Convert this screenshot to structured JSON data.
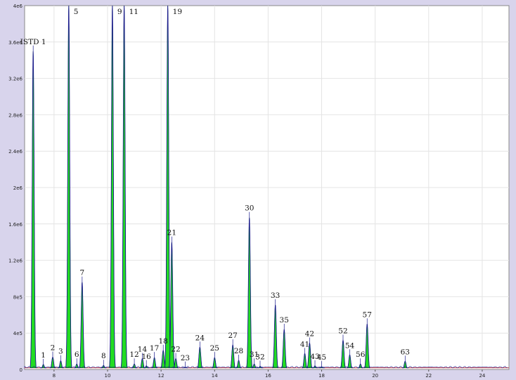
{
  "chart_data": {
    "type": "line",
    "title": "",
    "xlabel": "",
    "ylabel": "",
    "xlim": [
      6.9,
      25.0
    ],
    "ylim": [
      0,
      4000000
    ],
    "grid": true,
    "legend": "none",
    "x_ticks": [
      8,
      10,
      12,
      14,
      16,
      18,
      20,
      22,
      24
    ],
    "x_tick_labels": [
      "8",
      "10",
      "12",
      "14",
      "16",
      "18",
      "20",
      "22",
      "24"
    ],
    "y_ticks": [
      0,
      400000,
      800000,
      1200000,
      1600000,
      2000000,
      2400000,
      2800000,
      3200000,
      3600000,
      4000000
    ],
    "y_tick_labels": [
      "0",
      "4e5",
      "8e5",
      "1.2e6",
      "1.6e6",
      "2e6",
      "2.4e6",
      "2.8e6",
      "3.2e6",
      "3.6e6",
      "4e6"
    ],
    "colors": {
      "trace": "#1a1a8c",
      "fill": "#22dd22",
      "fill_stroke": "#0a7a0a",
      "baseline": "#cc3333",
      "plot_bg": "#ffffff",
      "grid": "#e4e4e4"
    },
    "peaks": [
      {
        "label": "ISTD 1",
        "x": 7.22,
        "y": 3500000
      },
      {
        "label": "1",
        "x": 7.6,
        "y": 55000
      },
      {
        "label": "2",
        "x": 7.95,
        "y": 135000
      },
      {
        "label": "3",
        "x": 8.25,
        "y": 95000
      },
      {
        "label": "5",
        "x": 8.55,
        "y": 4000000
      },
      {
        "label": "6",
        "x": 8.85,
        "y": 60000
      },
      {
        "label": "7",
        "x": 9.05,
        "y": 960000
      },
      {
        "label": "8",
        "x": 9.85,
        "y": 45000
      },
      {
        "label": "9",
        "x": 10.18,
        "y": 4000000
      },
      {
        "label": "11",
        "x": 10.62,
        "y": 4000000
      },
      {
        "label": "12",
        "x": 11.0,
        "y": 60000
      },
      {
        "label": "14",
        "x": 11.3,
        "y": 120000
      },
      {
        "label": "16",
        "x": 11.45,
        "y": 40000
      },
      {
        "label": "17",
        "x": 11.75,
        "y": 130000
      },
      {
        "label": "18",
        "x": 12.08,
        "y": 210000
      },
      {
        "label": "19",
        "x": 12.25,
        "y": 4000000
      },
      {
        "label": "21",
        "x": 12.4,
        "y": 1400000
      },
      {
        "label": "22",
        "x": 12.55,
        "y": 120000
      },
      {
        "label": "23",
        "x": 12.9,
        "y": 25000
      },
      {
        "label": "24",
        "x": 13.45,
        "y": 245000
      },
      {
        "label": "25",
        "x": 14.0,
        "y": 130000
      },
      {
        "label": "27",
        "x": 14.68,
        "y": 270000
      },
      {
        "label": "28",
        "x": 14.9,
        "y": 100000
      },
      {
        "label": "30",
        "x": 15.3,
        "y": 1670000
      },
      {
        "label": "31",
        "x": 15.48,
        "y": 60000
      },
      {
        "label": "32",
        "x": 15.7,
        "y": 35000
      },
      {
        "label": "33",
        "x": 16.27,
        "y": 710000
      },
      {
        "label": "35",
        "x": 16.6,
        "y": 440000
      },
      {
        "label": "41",
        "x": 17.37,
        "y": 175000
      },
      {
        "label": "42",
        "x": 17.55,
        "y": 290000
      },
      {
        "label": "43",
        "x": 17.75,
        "y": 40000
      },
      {
        "label": "45",
        "x": 18.0,
        "y": 30000
      },
      {
        "label": "52",
        "x": 18.8,
        "y": 320000
      },
      {
        "label": "54",
        "x": 19.05,
        "y": 160000
      },
      {
        "label": "56",
        "x": 19.45,
        "y": 60000
      },
      {
        "label": "57",
        "x": 19.7,
        "y": 500000
      },
      {
        "label": "63",
        "x": 21.12,
        "y": 90000
      }
    ]
  }
}
